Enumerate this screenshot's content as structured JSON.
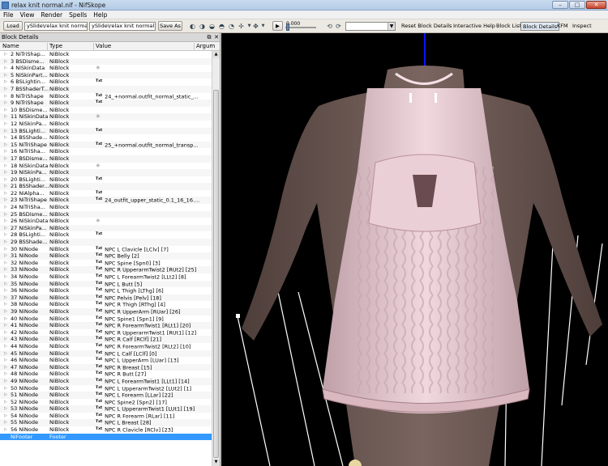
{
  "window": {
    "title": "relax knit normal.nif - NifSkope"
  },
  "menu": [
    "File",
    "View",
    "Render",
    "Spells",
    "Help"
  ],
  "toolbar": {
    "load_label": "Load",
    "load_path": "ySlide\\relax knit normal.nif",
    "save_path": "ySlide\\relax knit normal.nif",
    "saveas_label": "Save As",
    "time_value": "0.000",
    "links": [
      "Reset Block Details",
      "Interactive Help",
      "Block List",
      "Block Details",
      "KFM",
      "Inspect"
    ]
  },
  "panel": {
    "title": "Block Details",
    "columns": [
      "Name",
      "Type",
      "Value",
      "Argum"
    ],
    "rows": [
      {
        "name": "2 NiTriShap...",
        "type": "NiBlock",
        "value": "",
        "txt": false,
        "star": false
      },
      {
        "name": "3 BSDisme...",
        "type": "NiBlock",
        "value": "",
        "txt": false,
        "star": false
      },
      {
        "name": "4 NiSkinData",
        "type": "NiBlock",
        "value": "",
        "txt": false,
        "star": true
      },
      {
        "name": "5 NiSkinPart...",
        "type": "NiBlock",
        "value": "",
        "txt": false,
        "star": false
      },
      {
        "name": "6 BSLightin...",
        "type": "NiBlock",
        "value": "",
        "txt": true,
        "star": false
      },
      {
        "name": "7 BSShaderT...",
        "type": "NiBlock",
        "value": "",
        "txt": false,
        "star": false
      },
      {
        "name": "8 NiTriShape",
        "type": "NiBlock",
        "value": "24_+normal.outfit_normal_static_...",
        "txt": true,
        "star": false
      },
      {
        "name": "9 NiTriShape",
        "type": "NiBlock",
        "value": "",
        "txt": true,
        "star": false
      },
      {
        "name": "10 BSDisme...",
        "type": "NiBlock",
        "value": "",
        "txt": false,
        "star": false
      },
      {
        "name": "11 NiSkinData",
        "type": "NiBlock",
        "value": "",
        "txt": false,
        "star": true
      },
      {
        "name": "12 NiSkinPa...",
        "type": "NiBlock",
        "value": "",
        "txt": false,
        "star": false
      },
      {
        "name": "13 BSLighti...",
        "type": "NiBlock",
        "value": "",
        "txt": true,
        "star": false
      },
      {
        "name": "14 BSShade...",
        "type": "NiBlock",
        "value": "",
        "txt": false,
        "star": false
      },
      {
        "name": "15 NiTriShape",
        "type": "NiBlock",
        "value": "25_+normal.outfit_normal_transp...",
        "txt": true,
        "star": false
      },
      {
        "name": "16 NiTriSha...",
        "type": "NiBlock",
        "value": "",
        "txt": false,
        "star": false
      },
      {
        "name": "17 BSDisme...",
        "type": "NiBlock",
        "value": "",
        "txt": false,
        "star": false
      },
      {
        "name": "18 NiSkinData",
        "type": "NiBlock",
        "value": "",
        "txt": false,
        "star": true
      },
      {
        "name": "19 NiSkinPa...",
        "type": "NiBlock",
        "value": "",
        "txt": false,
        "star": false
      },
      {
        "name": "20 BSLighti...",
        "type": "NiBlock",
        "value": "",
        "txt": true,
        "star": false
      },
      {
        "name": "21 BSShader...",
        "type": "NiBlock",
        "value": "",
        "txt": false,
        "star": false
      },
      {
        "name": "22 NiAlpha...",
        "type": "NiBlock",
        "value": "",
        "txt": true,
        "star": false
      },
      {
        "name": "23 NiTriShape",
        "type": "NiBlock",
        "value": "24_outfit_upper_static_0.1_16_16....",
        "txt": true,
        "star": false
      },
      {
        "name": "24 NiTriSha...",
        "type": "NiBlock",
        "value": "",
        "txt": false,
        "star": false
      },
      {
        "name": "25 BSDisme...",
        "type": "NiBlock",
        "value": "",
        "txt": false,
        "star": false
      },
      {
        "name": "26 NiSkinData",
        "type": "NiBlock",
        "value": "",
        "txt": false,
        "star": true
      },
      {
        "name": "27 NiSkinPa...",
        "type": "NiBlock",
        "value": "",
        "txt": false,
        "star": false
      },
      {
        "name": "28 BSLighti...",
        "type": "NiBlock",
        "value": "",
        "txt": true,
        "star": false
      },
      {
        "name": "29 BSShade...",
        "type": "NiBlock",
        "value": "",
        "txt": false,
        "star": false
      },
      {
        "name": "30 NiNode",
        "type": "NiBlock",
        "value": "NPC L Clavicle [LClv] [7]",
        "txt": true,
        "star": false
      },
      {
        "name": "31 NiNode",
        "type": "NiBlock",
        "value": "NPC Belly [2]",
        "txt": true,
        "star": false
      },
      {
        "name": "32 NiNode",
        "type": "NiBlock",
        "value": "NPC Spine [Spn0] [3]",
        "txt": true,
        "star": false
      },
      {
        "name": "33 NiNode",
        "type": "NiBlock",
        "value": "NPC R UpperarmTwist2 [RUt2] [25]",
        "txt": true,
        "star": false
      },
      {
        "name": "34 NiNode",
        "type": "NiBlock",
        "value": "NPC L ForearmTwist2 [LLt2] [8]",
        "txt": true,
        "star": false
      },
      {
        "name": "35 NiNode",
        "type": "NiBlock",
        "value": "NPC L Butt [5]",
        "txt": true,
        "star": false
      },
      {
        "name": "36 NiNode",
        "type": "NiBlock",
        "value": "NPC L Thigh [LThg] [6]",
        "txt": true,
        "star": false
      },
      {
        "name": "37 NiNode",
        "type": "NiBlock",
        "value": "NPC Pelvis [Pelv] [18]",
        "txt": true,
        "star": false
      },
      {
        "name": "38 NiNode",
        "type": "NiBlock",
        "value": "NPC R Thigh [RThg] [4]",
        "txt": true,
        "star": false
      },
      {
        "name": "39 NiNode",
        "type": "NiBlock",
        "value": "NPC R UpperArm [RUar] [26]",
        "txt": true,
        "star": false
      },
      {
        "name": "40 NiNode",
        "type": "NiBlock",
        "value": "NPC Spine1 [Spn1] [9]",
        "txt": true,
        "star": false
      },
      {
        "name": "41 NiNode",
        "type": "NiBlock",
        "value": "NPC R ForearmTwist1 [RLt1] [20]",
        "txt": true,
        "star": false
      },
      {
        "name": "42 NiNode",
        "type": "NiBlock",
        "value": "NPC R UpperarmTwist1 [RUt1] [12]",
        "txt": true,
        "star": false
      },
      {
        "name": "43 NiNode",
        "type": "NiBlock",
        "value": "NPC R Calf [RClf] [21]",
        "txt": true,
        "star": false
      },
      {
        "name": "44 NiNode",
        "type": "NiBlock",
        "value": "NPC R ForearmTwist2 [RLt2] [10]",
        "txt": true,
        "star": false
      },
      {
        "name": "45 NiNode",
        "type": "NiBlock",
        "value": "NPC L Calf [LClf] [0]",
        "txt": true,
        "star": false
      },
      {
        "name": "46 NiNode",
        "type": "NiBlock",
        "value": "NPC L UpperArm [LUar] [13]",
        "txt": true,
        "star": false
      },
      {
        "name": "47 NiNode",
        "type": "NiBlock",
        "value": "NPC R Breast [15]",
        "txt": true,
        "star": false
      },
      {
        "name": "48 NiNode",
        "type": "NiBlock",
        "value": "NPC R Butt [27]",
        "txt": true,
        "star": false
      },
      {
        "name": "49 NiNode",
        "type": "NiBlock",
        "value": "NPC L ForearmTwist1 [LLt1] [14]",
        "txt": true,
        "star": false
      },
      {
        "name": "50 NiNode",
        "type": "NiBlock",
        "value": "NPC L UpperarmTwist2 [LUt2] [1]",
        "txt": true,
        "star": false
      },
      {
        "name": "51 NiNode",
        "type": "NiBlock",
        "value": "NPC L Forearm [LLar] [22]",
        "txt": true,
        "star": false
      },
      {
        "name": "52 NiNode",
        "type": "NiBlock",
        "value": "NPC Spine2 [Spn2] [17]",
        "txt": true,
        "star": false
      },
      {
        "name": "53 NiNode",
        "type": "NiBlock",
        "value": "NPC L UpperarmTwist1 [LUt1] [19]",
        "txt": true,
        "star": false
      },
      {
        "name": "54 NiNode",
        "type": "NiBlock",
        "value": "NPC R Forearm [RLar] [11]",
        "txt": true,
        "star": false
      },
      {
        "name": "55 NiNode",
        "type": "NiBlock",
        "value": "NPC L Breast [28]",
        "txt": true,
        "star": false
      },
      {
        "name": "56 NiNode",
        "type": "NiBlock",
        "value": "NPC R Clavicle [RClv] [23]",
        "txt": true,
        "star": false
      },
      {
        "name": "NiFooter",
        "type": "Footer",
        "value": "",
        "txt": false,
        "star": false,
        "selected": true
      }
    ],
    "txt_badge": "Txt"
  },
  "colors": {
    "selection": "#3399ff",
    "viewport_bg": "#000000",
    "skin": "#6e5a55",
    "dress": "#e6c8cf",
    "axis_blue": "#1010ff"
  }
}
